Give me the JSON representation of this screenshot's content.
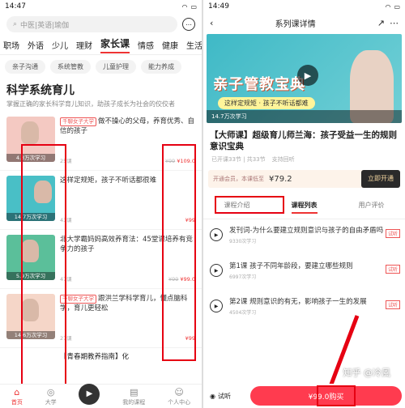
{
  "left": {
    "status_time": "14:47",
    "search_placeholder": "中医|英语|瑜伽",
    "categories": [
      "职场",
      "外语",
      "少儿",
      "理财",
      "家长课",
      "情感",
      "健康",
      "生活"
    ],
    "subtags": [
      "亲子沟通",
      "系统管教",
      "儿童护理",
      "能力养成"
    ],
    "section_title": "科学系统育儿",
    "section_desc": "掌握正确的家长科学育儿知识，助孩子成长为社会的佼佼者",
    "courses": [
      {
        "tag": "千聊女子大学",
        "title": "做不操心的父母，养育优秀、自信的孩子",
        "count": "4.3万次学习",
        "students": "25课",
        "old_price": "¥99",
        "price": "¥109.0"
      },
      {
        "tag": "",
        "title": "这样定规矩，孩子不听话都很难",
        "count": "14.7万次学习",
        "students": "43课",
        "old_price": "",
        "price": "¥99"
      },
      {
        "tag": "",
        "title": "北大学霸妈妈高效养育法：45堂课培养有竞争力的孩子",
        "count": "5.9万次学习",
        "students": "47课",
        "old_price": "¥99",
        "price": "¥99.0"
      },
      {
        "tag": "千聊女子大学",
        "title": "跟洪兰学科学育儿，懂点脑科学，育儿更轻松",
        "count": "14.6万次学习",
        "students": "27课",
        "old_price": "",
        "price": "¥99"
      }
    ],
    "next_course": "【青春期教养指南】化",
    "tabs": [
      "首页",
      "大学",
      "",
      "我的课程",
      "个人中心"
    ]
  },
  "right": {
    "status_time": "14:49",
    "nav_title": "系列课详情",
    "banner_title": "亲子管教宝典",
    "banner_slogan": "这样定规矩 · 孩子不听话都难",
    "banner_count": "14.7万次学习",
    "course_title": "【大师课】超级育儿师兰海：孩子受益一生的规则意识宝典",
    "progress": "已开课33节 | 共33节",
    "progress_extra": "支持回听",
    "vip_text": "开通会员，本课低至",
    "vip_price": "¥79.2",
    "vip_button": "立即开通",
    "tabs": [
      "课程介绍",
      "课程列表",
      "用户评价"
    ],
    "lessons": [
      {
        "title": "发刊词-为什么要建立规则意识与孩子的自由矛盾吗",
        "sub": "9330次学习",
        "trial": "试听"
      },
      {
        "title": "第1课 孩子不同年龄段，要建立哪些规则",
        "sub": "6997次学习",
        "trial": "试听"
      },
      {
        "title": "第2课 规则意识的有无，影响孩子一生的发展",
        "sub": "4504次学习",
        "trial": "试听"
      }
    ],
    "listen_label": "试听",
    "buy_label": "¥99.0购买",
    "watermark": "知乎 @冷風"
  },
  "accent": "#e60012"
}
